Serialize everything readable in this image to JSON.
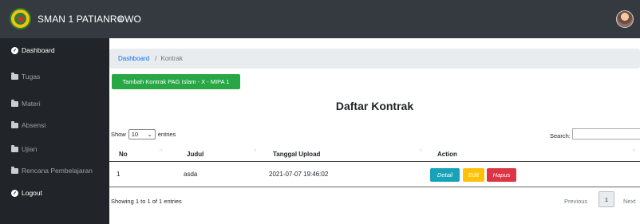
{
  "header": {
    "brand": "SMAN 1 PATIANROWO",
    "menu_glyph": "≡",
    "logo_icon": "school-emblem-icon",
    "avatar_icon": "user-avatar-icon"
  },
  "sidebar": {
    "items": [
      {
        "label": "Dashboard",
        "icon": "dashboard-gauge-icon"
      },
      {
        "label": "Tugas",
        "icon": "folder-icon"
      },
      {
        "label": "Materi",
        "icon": "folder-icon"
      },
      {
        "label": "Absensi",
        "icon": "folder-icon"
      },
      {
        "label": "Ujian",
        "icon": "folder-icon"
      },
      {
        "label": "Rencana Pembelajaran",
        "icon": "folder-icon"
      },
      {
        "label": "Logout",
        "icon": "dashboard-gauge-icon"
      }
    ]
  },
  "breadcrumb": {
    "home": "Dashboard",
    "separator": "/",
    "current": "Kontrak"
  },
  "add_button": "Tambah Kontrak PAG Islam - X - MIPA 1",
  "title": "Daftar Kontrak",
  "table_controls": {
    "show_label": "Show",
    "entries_value": "10",
    "entries_label": "entries",
    "search_label": "Search:",
    "search_value": ""
  },
  "table": {
    "columns": [
      "No",
      "Judul",
      "Tanggal Upload",
      "Action"
    ],
    "rows": [
      {
        "no": "1",
        "judul": "asda",
        "tanggal": "2021-07-07 19:46:02"
      }
    ],
    "actions": {
      "detail": "Detail",
      "edit": "Edit",
      "hapus": "Hapus"
    }
  },
  "footer": {
    "info": "Showing 1 to 1 of 1 entries",
    "previous": "Previous",
    "page": "1",
    "next": "Next"
  },
  "colors": {
    "topbar": "#343a40",
    "sidebar": "#212529",
    "success": "#28a745",
    "info": "#17a2b8",
    "warning": "#ffc107",
    "danger": "#dc3545"
  }
}
